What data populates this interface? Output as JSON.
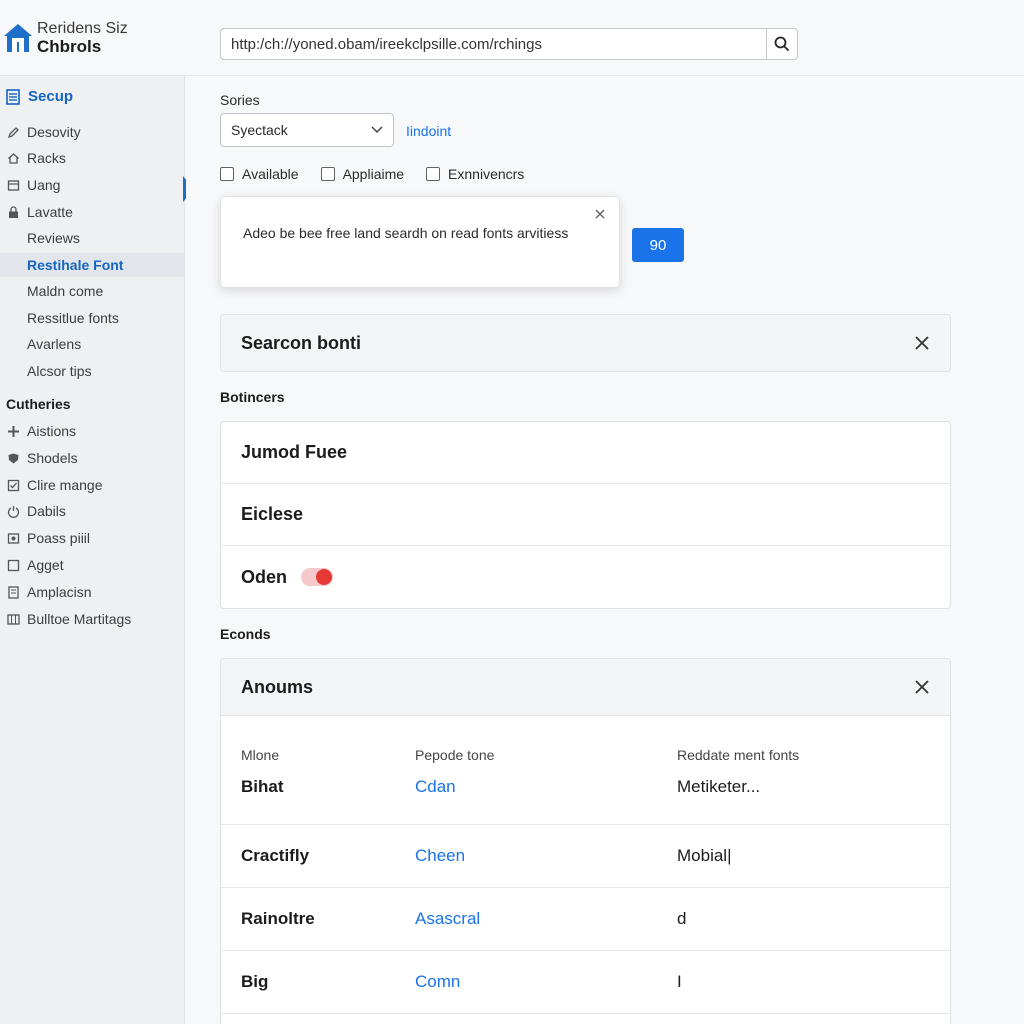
{
  "header": {
    "logo_line1": "Reridens Siz",
    "logo_line2": "Chbrols",
    "url": "http:/ch://yoned.obam/ireekclpsille.com/rchings"
  },
  "sidebar": {
    "header": "Secup",
    "items": [
      {
        "label": "Desovity",
        "icon": "pencil-icon"
      },
      {
        "label": "Racks",
        "icon": "home-icon"
      },
      {
        "label": "Uang",
        "icon": "window-icon"
      },
      {
        "label": "Lavatte",
        "icon": "lock-icon"
      },
      {
        "label": "Reviews",
        "icon": ""
      },
      {
        "label": "Restihale Font",
        "icon": "",
        "active": true
      },
      {
        "label": "Maldn come",
        "icon": ""
      },
      {
        "label": "Ressitlue fonts",
        "icon": ""
      },
      {
        "label": "Avarlens",
        "icon": ""
      },
      {
        "label": "Alcsor tips",
        "icon": ""
      }
    ],
    "section2_title": "Cutheries",
    "section2_items": [
      {
        "label": "Aistions",
        "icon": "plus-cross-icon"
      },
      {
        "label": "Shodels",
        "icon": "shield-icon"
      },
      {
        "label": "Clire mange",
        "icon": "checkbox-icon"
      },
      {
        "label": "Dabils",
        "icon": "power-icon"
      },
      {
        "label": "Poass piiil",
        "icon": "image-icon"
      },
      {
        "label": "Agget",
        "icon": "square-icon"
      },
      {
        "label": "Amplacisn",
        "icon": "file-icon"
      },
      {
        "label": "Bulltoe Martitags",
        "icon": "grid-icon"
      }
    ]
  },
  "main": {
    "sories_label": "Sories",
    "select_value": "Syectack",
    "link_label": "Iindoint",
    "checkboxes": [
      "Available",
      "Appliaime",
      "Exnnivencrs"
    ],
    "popup_text": "Adeo be bee free land seardh on read fonts arvitiess",
    "blue_button": "90",
    "search_card_title": "Searcon bonti",
    "section1_label": "Botincers",
    "list_items": [
      "Jumod Fuee",
      "Eiclese",
      "Oden"
    ],
    "section2_label": "Econds",
    "table_title": "Anoums",
    "table_headers": [
      "Mlone",
      "Pepode tone",
      "Reddate ment fonts"
    ],
    "table_rows": [
      [
        "Bihat",
        "Cdan",
        "Metiketer..."
      ],
      [
        "Cractifly",
        "Cheen",
        "Mobial|"
      ],
      [
        "Rainoltre",
        "Asascral",
        "d"
      ],
      [
        "Big",
        "Comn",
        "I"
      ]
    ]
  },
  "colors": {
    "accent": "#1a73e8",
    "active_text": "#1565c0",
    "toggle_knob": "#e53935"
  }
}
